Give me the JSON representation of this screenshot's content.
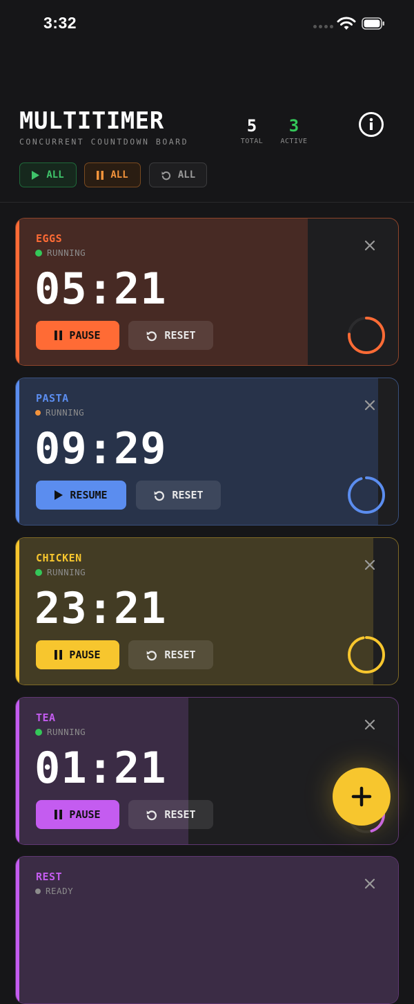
{
  "status": {
    "time": "3:32"
  },
  "header": {
    "title": "MULTITIMER",
    "subtitle": "CONCURRENT COUNTDOWN BOARD",
    "total_count": "5",
    "total_label": "TOTAL",
    "active_count": "3",
    "active_label": "ACTIVE",
    "info_icon": "info-circle-icon"
  },
  "global_controls": {
    "play_all_label": "ALL",
    "pause_all_label": "ALL",
    "reset_all_label": "ALL"
  },
  "colors": {
    "orange": "#ff6b35",
    "blue": "#5b8def",
    "yellow": "#f7c62e",
    "purple": "#c45cf0",
    "green": "#34c759"
  },
  "timers": [
    {
      "name": "EGGS",
      "state": "RUNNING",
      "time": "05:21",
      "primary_label": "PAUSE",
      "reset_label": "RESET",
      "remaining_fraction": 0.76
    },
    {
      "name": "PASTA",
      "state": "RUNNING",
      "time": "09:29",
      "primary_label": "RESUME",
      "reset_label": "RESET",
      "remaining_fraction": 0.95
    },
    {
      "name": "CHICKEN",
      "state": "RUNNING",
      "time": "23:21",
      "primary_label": "PAUSE",
      "reset_label": "RESET",
      "remaining_fraction": 0.97
    },
    {
      "name": "TEA",
      "state": "RUNNING",
      "time": "01:21",
      "primary_label": "PAUSE",
      "reset_label": "RESET",
      "remaining_fraction": 0.45
    },
    {
      "name": "REST",
      "state": "READY"
    }
  ]
}
